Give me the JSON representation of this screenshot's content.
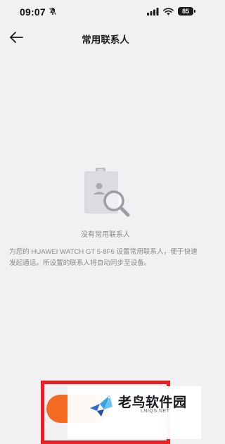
{
  "status_bar": {
    "time": "09:07",
    "battery": "85",
    "icons": [
      "bell-muted-icon",
      "cellular-icon",
      "wifi-icon",
      "battery-icon"
    ]
  },
  "header": {
    "title": "常用联系人",
    "back_icon": "arrow-left-icon"
  },
  "empty_state": {
    "icon": "contacts-search-illustration",
    "title": "没有常用联系人",
    "description": "为您的 HUAWEI WATCH GT 5-8F6 设置常用联系人，便于快速发起通话。所设置的联系人将自动同步至设备。"
  },
  "watermark": {
    "name": "老鸟软件园",
    "url": "LNIQS.NET"
  },
  "colors": {
    "background": "#f1f1f3",
    "accent": "#f36a23",
    "highlight_frame": "#ea1f1f"
  }
}
